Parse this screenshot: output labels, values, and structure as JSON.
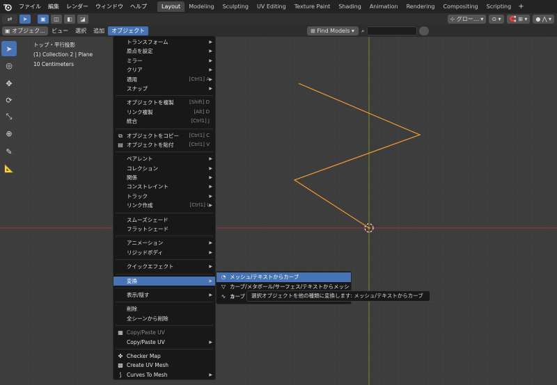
{
  "topbar": {
    "menus": [
      "ファイル",
      "編集",
      "レンダー",
      "ウィンドウ",
      "ヘルプ"
    ],
    "workspaces": [
      "Layout",
      "Modeling",
      "Sculpting",
      "UV Editing",
      "Texture Paint",
      "Shading",
      "Animation",
      "Rendering",
      "Compositing",
      "Scripting"
    ],
    "active_workspace": "Layout",
    "add_label": "+"
  },
  "toolbar": {
    "transform_orientation": "グロー…"
  },
  "header": {
    "mode": "オブジェク…",
    "menus": [
      "ビュー",
      "選択",
      "追加",
      "オブジェクト"
    ],
    "active_menu": "オブジェクト",
    "find_models": "Find Models"
  },
  "viewport": {
    "view_name": "トップ・平行投影",
    "collection": "(1) Collection 2 | Plane",
    "scale": "10 Centimeters"
  },
  "context_menu": {
    "groups": [
      [
        {
          "label": "トランスフォーム",
          "submenu": true
        },
        {
          "label": "原点を設定",
          "submenu": true
        },
        {
          "label": "ミラー",
          "submenu": true
        },
        {
          "label": "クリア",
          "submenu": true
        },
        {
          "label": "適用",
          "shortcut": "[Ctrl1] A",
          "submenu": true
        },
        {
          "label": "スナップ",
          "submenu": true
        }
      ],
      [
        {
          "label": "オブジェクトを複製",
          "shortcut": "[Shift] D"
        },
        {
          "label": "リンク複製",
          "shortcut": "[Alt] D"
        },
        {
          "label": "統合",
          "shortcut": "[Ctrl1] J"
        }
      ],
      [
        {
          "label": "オブジェクトをコピー",
          "shortcut": "[Ctrl1] C",
          "icon": "copy-icon"
        },
        {
          "label": "オブジェクトを貼付",
          "shortcut": "[Ctrl1] V",
          "icon": "paste-icon"
        }
      ],
      [
        {
          "label": "ペアレント",
          "submenu": true
        },
        {
          "label": "コレクション",
          "submenu": true
        },
        {
          "label": "関係",
          "submenu": true
        },
        {
          "label": "コンストレイント",
          "submenu": true
        },
        {
          "label": "トラック",
          "submenu": true
        },
        {
          "label": "リンク作成",
          "shortcut": "[Ctrl1] L",
          "submenu": true
        }
      ],
      [
        {
          "label": "スムーズシェード"
        },
        {
          "label": "フラットシェード"
        }
      ],
      [
        {
          "label": "アニメーション",
          "submenu": true
        },
        {
          "label": "リジッドボディ",
          "submenu": true
        }
      ],
      [
        {
          "label": "クイックエフェクト",
          "submenu": true
        }
      ],
      [
        {
          "label": "変換",
          "submenu": true,
          "active": true
        }
      ],
      [
        {
          "label": "表示/隠す",
          "submenu": true
        }
      ],
      [
        {
          "label": "削除"
        },
        {
          "label": "全シーンから削除"
        }
      ],
      [
        {
          "label": "Copy/Paste UV",
          "disabled": true,
          "icon": "uv-icon"
        },
        {
          "label": "Copy/Paste UV",
          "submenu": true
        }
      ],
      [
        {
          "label": "Checker Map",
          "icon": "checker-icon"
        },
        {
          "label": "Create UV Mesh",
          "icon": "uv-mesh-icon"
        },
        {
          "label": "Curves To Mesh",
          "submenu": true,
          "icon": "curve-mesh-icon"
        }
      ]
    ]
  },
  "convert_submenu": {
    "items": [
      {
        "label": "メッシュ/テキストからカーブ",
        "active": true,
        "icon": "curve-icon"
      },
      {
        "label": "カーブ/メタボール/サーフェス/テキストからメッシュ",
        "icon": "mesh-icon"
      },
      {
        "label": "カーブ",
        "icon": "curve2-icon"
      }
    ]
  },
  "tooltip": {
    "text": "選択オブジェクトを他の種類に変換します: メッシュ/テキストからカーブ"
  },
  "colors": {
    "accent": "#4772b3",
    "curve": "#f29b2e",
    "x_axis": "#a0363d",
    "y_axis": "#6d8f2c"
  }
}
